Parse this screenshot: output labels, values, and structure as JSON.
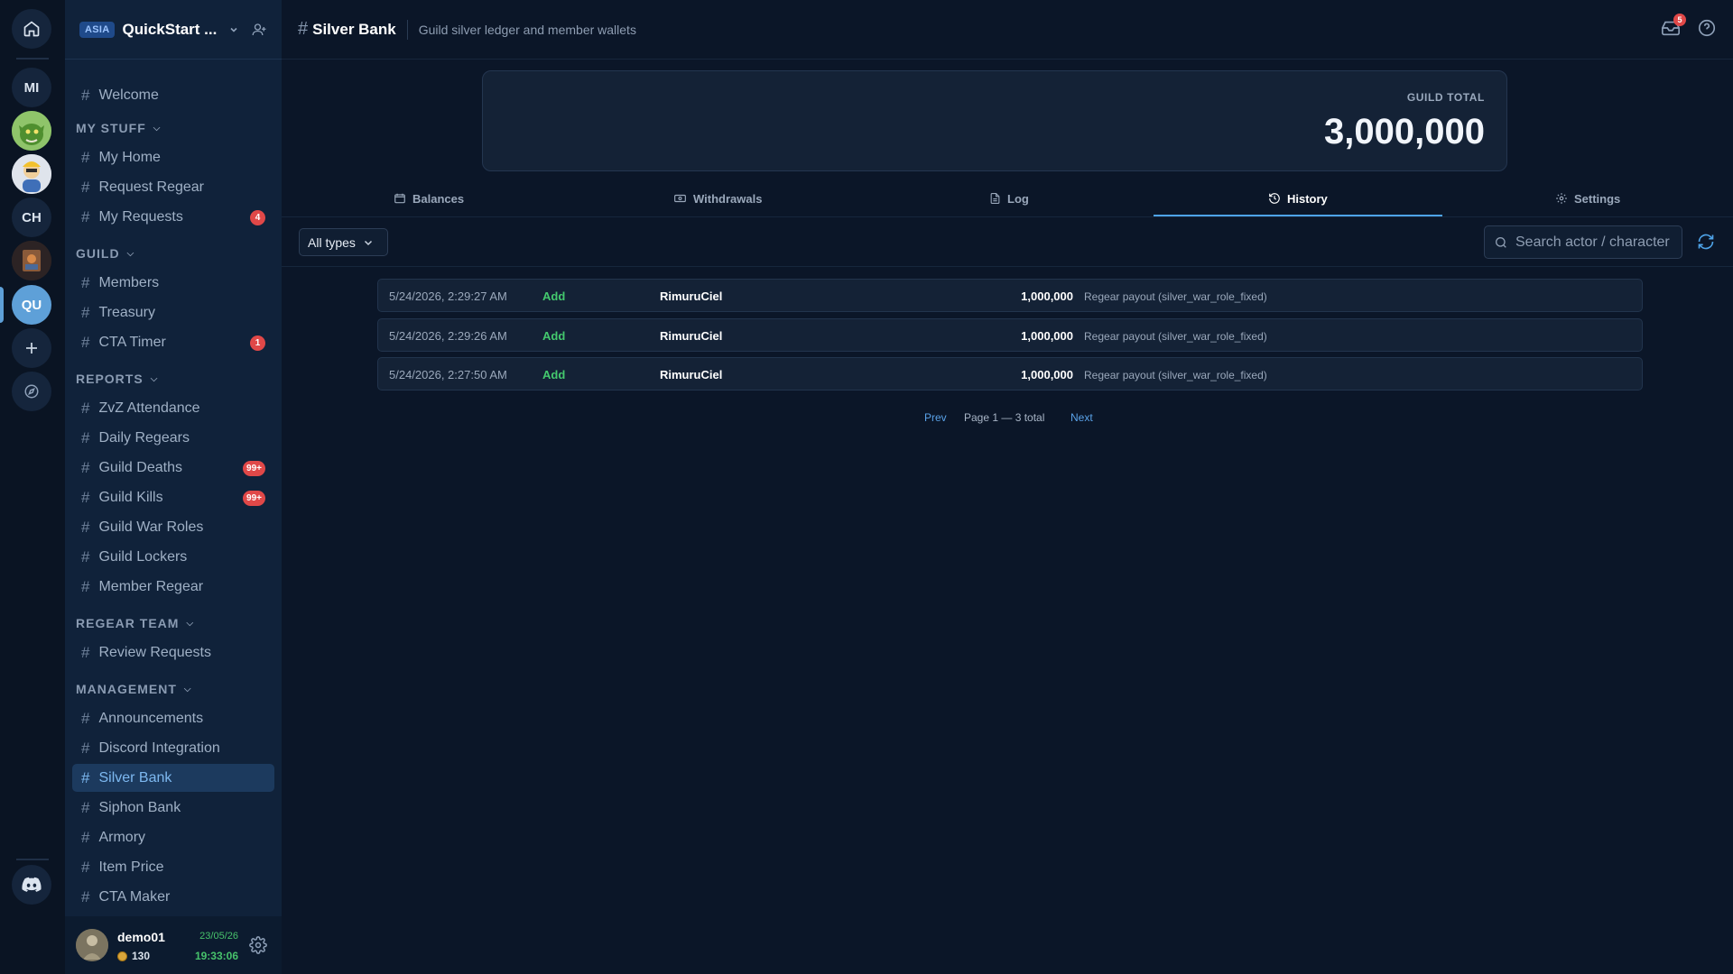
{
  "rail": {
    "servers": [
      "MI",
      "CH",
      "QU"
    ]
  },
  "server": {
    "region": "ASIA",
    "name": "QuickStart ..."
  },
  "channels": {
    "welcome": "Welcome",
    "cat_my_stuff": "MY STUFF",
    "my_home": "My Home",
    "request_regear": "Request Regear",
    "my_requests": "My Requests",
    "my_requests_badge": "4",
    "cat_guild": "GUILD",
    "members": "Members",
    "treasury": "Treasury",
    "cta_timer": "CTA Timer",
    "cta_timer_badge": "1",
    "cat_reports": "REPORTS",
    "zvz_attendance": "ZvZ Attendance",
    "daily_regears": "Daily Regears",
    "guild_deaths": "Guild Deaths",
    "guild_deaths_badge": "99+",
    "guild_kills": "Guild Kills",
    "guild_kills_badge": "99+",
    "guild_war_roles": "Guild War Roles",
    "guild_lockers": "Guild Lockers",
    "member_regear": "Member Regear",
    "cat_regear_team": "REGEAR TEAM",
    "review_requests": "Review Requests",
    "cat_management": "MANAGEMENT",
    "announcements": "Announcements",
    "discord_integration": "Discord Integration",
    "silver_bank": "Silver Bank",
    "siphon_bank": "Siphon Bank",
    "armory": "Armory",
    "item_price": "Item Price",
    "cta_maker": "CTA Maker"
  },
  "user": {
    "name": "demo01",
    "coins": "130",
    "date": "23/05/26",
    "time": "19:33:06"
  },
  "header": {
    "title": "Silver Bank",
    "description": "Guild silver ledger and member wallets",
    "notifications": "5"
  },
  "summary": {
    "label": "GUILD TOTAL",
    "value": "3,000,000"
  },
  "tabs": {
    "balances": "Balances",
    "withdrawals": "Withdrawals",
    "log": "Log",
    "history": "History",
    "settings": "Settings",
    "active": "History"
  },
  "filter": {
    "type": "All types",
    "search_placeholder": "Search actor / character"
  },
  "history": [
    {
      "date": "5/24/2026, 2:29:27 AM",
      "type": "Add",
      "actor": "RimuruCiel",
      "amount": "1,000,000",
      "note": "Regear payout (silver_war_role_fixed)"
    },
    {
      "date": "5/24/2026, 2:29:26 AM",
      "type": "Add",
      "actor": "RimuruCiel",
      "amount": "1,000,000",
      "note": "Regear payout (silver_war_role_fixed)"
    },
    {
      "date": "5/24/2026, 2:27:50 AM",
      "type": "Add",
      "actor": "RimuruCiel",
      "amount": "1,000,000",
      "note": "Regear payout (silver_war_role_fixed)"
    }
  ],
  "pager": {
    "prev": "Prev",
    "info": "Page 1 — 3 total",
    "next": "Next"
  },
  "colors": {
    "accent": "#4ea3e8",
    "positive": "#44c96e",
    "badge": "#e04848",
    "active_channel_bg": "#1c3a5e"
  }
}
